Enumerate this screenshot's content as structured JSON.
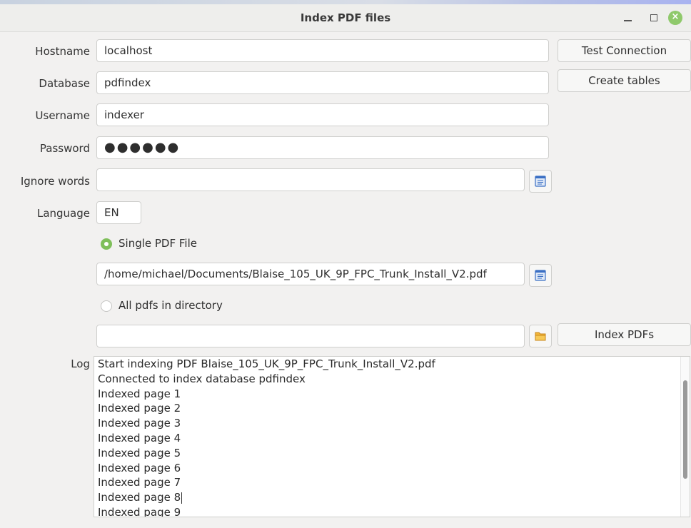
{
  "window": {
    "title": "Index PDF files",
    "controls": [
      "minimize-icon",
      "maximize-icon",
      "close-icon"
    ]
  },
  "form": {
    "hostname_label": "Hostname",
    "hostname_value": "localhost",
    "database_label": "Database",
    "database_value": "pdfindex",
    "username_label": "Username",
    "username_value": "indexer",
    "password_label": "Password",
    "password_mask": "●●●●●●",
    "ignore_label": "Ignore words",
    "ignore_value": "",
    "language_label": "Language",
    "language_value": "EN"
  },
  "buttons": {
    "test_connection": "Test Connection",
    "create_tables": "Create tables",
    "index_pdfs": "Index PDFs"
  },
  "source": {
    "single_label": "Single PDF File",
    "single_selected": true,
    "single_path": "/home/michael/Documents/Blaise_105_UK_9P_FPC_Trunk_Install_V2.pdf",
    "directory_label": "All pdfs in directory",
    "directory_selected": false,
    "directory_path": ""
  },
  "log": {
    "label": "Log",
    "lines": [
      "Start indexing PDF Blaise_105_UK_9P_FPC_Trunk_Install_V2.pdf",
      "Connected to index database pdfindex",
      "Indexed page 1",
      "Indexed page 2",
      "Indexed page 3",
      "Indexed page 4",
      "Indexed page 5",
      "Indexed page 6",
      "Indexed page 7",
      "Indexed page 8",
      "Indexed page 9"
    ]
  },
  "colors": {
    "radio_active": "#7fbf5a",
    "close_button": "#8fc96b"
  }
}
